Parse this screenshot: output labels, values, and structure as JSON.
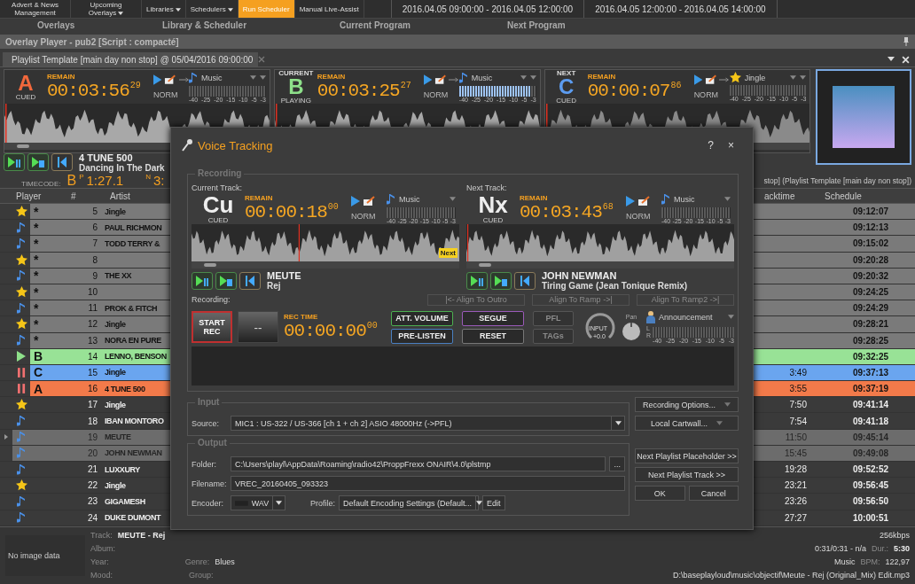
{
  "ribbon": [
    {
      "label": "Advert & News Management",
      "caret": false,
      "selected": false
    },
    {
      "label": "Upcoming Overlays",
      "caret": true,
      "selected": false
    },
    {
      "label": "Libraries",
      "caret": true,
      "selected": false
    },
    {
      "label": "Schedulers",
      "caret": true,
      "selected": false
    },
    {
      "label": "Run Scheduler",
      "caret": false,
      "selected": true
    },
    {
      "label": "Manual Live-Assist",
      "caret": false,
      "selected": false
    }
  ],
  "program_slots": [
    "2016.04.05 09:00:00 - 2016.04.05 12:00:00",
    "2016.04.05 12:00:00 - 2016.04.05 14:00:00"
  ],
  "groups": [
    "Overlays",
    "Library & Scheduler",
    "Current Program",
    "Next Program"
  ],
  "overlay_player": {
    "title": "Overlay Player - pub2 [Script : compacté]"
  },
  "tab": {
    "label": "Playlist Template [main day non stop] @ 05/04/2016 09:00:00",
    "selected": true
  },
  "decks": [
    {
      "letter": "A",
      "color": "#f2683c",
      "status": "CUED",
      "remain_label": "REMAIN",
      "time": "00:03:56",
      "frames": "29",
      "mode": "NORM",
      "category": "Music",
      "kind": "music",
      "meter_scale": [
        "-40",
        "-25",
        "-20",
        "-15",
        "-10",
        "-5",
        "-3"
      ]
    },
    {
      "letter": "B",
      "color": "#8ee08a",
      "heading": "CURRENT",
      "status": "PLAYING",
      "remain_label": "REMAIN",
      "time": "00:03:25",
      "frames": "27",
      "mode": "NORM",
      "category": "Music",
      "kind": "music",
      "meter_scale": [
        "-40",
        "-25",
        "-20",
        "-15",
        "-10",
        "-5",
        "-3"
      ],
      "level": 0.92
    },
    {
      "letter": "C",
      "color": "#5c9cf0",
      "heading": "NEXT",
      "status": "CUED",
      "remain_label": "REMAIN",
      "time": "00:00:07",
      "frames": "86",
      "mode": "NORM",
      "category": "Jingle",
      "kind": "jingle",
      "meter_scale": [
        "-40",
        "-25",
        "-20",
        "-15",
        "-10",
        "-5",
        "-3"
      ]
    }
  ],
  "now_playing": {
    "artist": "4 TUNE 500",
    "title": "Dancing In The Dark"
  },
  "timecode": {
    "label": "TIMECODE:",
    "deck": "B",
    "played_prefix": "P",
    "played": "1:27.1",
    "next_prefix": "N",
    "next": "3:"
  },
  "playlist_caption": "stop] (Playlist Template [main day non stop])",
  "table": {
    "columns": [
      "Player",
      "#",
      "Artist",
      "acktime",
      "Schedule"
    ],
    "rows": [
      {
        "kind": "jingle",
        "letter": "*",
        "number": "5",
        "artist": "Jingle",
        "schedule": "09:12:07",
        "color": "#7a7a7a",
        "dimmed": false,
        "focused": false
      },
      {
        "kind": "music",
        "letter": "*",
        "number": "6",
        "artist": "PAUL RICHMON",
        "schedule": "09:12:13",
        "color": "#7a7a7a",
        "dimmed": false,
        "focused": false
      },
      {
        "kind": "music",
        "letter": "*",
        "number": "7",
        "artist": "TODD TERRY &",
        "schedule": "09:15:02",
        "color": "#7a7a7a",
        "dimmed": false,
        "focused": false
      },
      {
        "kind": "jingle",
        "letter": "*",
        "number": "8",
        "schedule": "09:20:28",
        "color": "#7a7a7a",
        "dimmed": false,
        "focused": false
      },
      {
        "kind": "music",
        "letter": "*",
        "number": "9",
        "artist": "THE XX",
        "schedule": "09:20:32",
        "color": "#7a7a7a",
        "dimmed": false,
        "focused": false
      },
      {
        "kind": "jingle",
        "letter": "*",
        "number": "10",
        "schedule": "09:24:25",
        "color": "#7a7a7a",
        "dimmed": false,
        "focused": false
      },
      {
        "kind": "music",
        "letter": "*",
        "number": "11",
        "artist": "PROK & FITCH",
        "schedule": "09:24:29",
        "color": "#7a7a7a",
        "dimmed": false,
        "focused": false
      },
      {
        "kind": "jingle",
        "letter": "*",
        "number": "12",
        "artist": "Jingle",
        "schedule": "09:28:21",
        "color": "#7a7a7a",
        "dimmed": false,
        "focused": false
      },
      {
        "kind": "music",
        "letter": "*",
        "number": "13",
        "artist": "NORA EN PURE",
        "schedule": "09:28:25",
        "color": "#7a7a7a",
        "dimmed": false,
        "focused": false
      },
      {
        "kind": "playing",
        "letter": "B",
        "number": "14",
        "artist": "LENNO, BENSON",
        "schedule": "09:32:25",
        "color": "#98e296",
        "dimmed": false,
        "focused": false
      },
      {
        "kind": "paused",
        "letter": "C",
        "number": "15",
        "artist": "Jingle",
        "backtime": "3:49",
        "schedule": "09:37:13",
        "color": "#6aa5ef",
        "dimmed": false,
        "focused": false
      },
      {
        "kind": "paused",
        "letter": "A",
        "number": "16",
        "artist": "4 TUNE 500",
        "backtime": "3:55",
        "schedule": "09:37:19",
        "color": "#f27a4a",
        "dimmed": false,
        "focused": false
      },
      {
        "kind": "jingle",
        "number": "17",
        "artist": "Jingle",
        "backtime": "7:50",
        "schedule": "09:41:14",
        "color": "#3a3a3a",
        "dimmed": false,
        "focused": false
      },
      {
        "kind": "music",
        "number": "18",
        "artist": "IBAN MONTORO",
        "backtime": "7:54",
        "schedule": "09:41:18",
        "color": "#3a3a3a",
        "dimmed": false,
        "focused": false
      },
      {
        "kind": "music",
        "number": "19",
        "artist": "MEUTE",
        "backtime": "11:50",
        "schedule": "09:45:14",
        "color": "#6c6c6c",
        "dimmed": true,
        "focused": true
      },
      {
        "kind": "music",
        "number": "20",
        "artist": "JOHN NEWMAN",
        "backtime": "15:45",
        "schedule": "09:49:08",
        "color": "#6c6c6c",
        "dimmed": true,
        "focused": false
      },
      {
        "kind": "music",
        "number": "21",
        "artist": "LUXXURY",
        "backtime": "19:28",
        "schedule": "09:52:52",
        "color": "#3a3a3a",
        "dimmed": false,
        "focused": false
      },
      {
        "kind": "jingle",
        "number": "22",
        "artist": "Jingle",
        "backtime": "23:21",
        "schedule": "09:56:45",
        "color": "#3a3a3a",
        "dimmed": false,
        "focused": false
      },
      {
        "kind": "music",
        "number": "23",
        "artist": "GIGAMESH",
        "backtime": "23:26",
        "schedule": "09:56:50",
        "color": "#3a3a3a",
        "dimmed": false,
        "focused": false
      },
      {
        "kind": "music",
        "number": "24",
        "artist": "DUKE DUMONT",
        "backtime": "27:27",
        "schedule": "10:00:51",
        "color": "#3a3a3a",
        "dimmed": false,
        "focused": false
      }
    ]
  },
  "info": {
    "image": "No image data",
    "track_label": "Track:",
    "track": "MEUTE - Rej",
    "album_label": "Album:",
    "year_label": "Year:",
    "genre_label": "Genre:",
    "genre": "Blues",
    "mood_label": "Mood:",
    "group_label": "Group:",
    "bitrate": "256kbps",
    "position": "0:31/0:31 - n/a",
    "duration_label": "Dur.:",
    "duration": "5:30",
    "category": "Music",
    "bpm_label": "BPM:",
    "bpm": "122,97",
    "path": "D:\\baseplayloud\\music\\objectif\\Meute - Rej (Original_Mix) Edit.mp3"
  },
  "dialog": {
    "title": "Voice Tracking",
    "help": "?",
    "close": "×",
    "recording_legend": "Recording",
    "tracks": [
      {
        "label": "Current Track:",
        "code": "Cu",
        "status": "CUED",
        "remain_label": "REMAIN",
        "time": "00:00:18",
        "frames": "00",
        "mode": "NORM",
        "category": "Music",
        "meter_scale": [
          "-40",
          "-25",
          "-20",
          "-15",
          "-10",
          "-5",
          "-3"
        ],
        "marker": "Next",
        "artist": "MEUTE",
        "title": "Rej"
      },
      {
        "label": "Next Track:",
        "code": "Nx",
        "status": "CUED",
        "remain_label": "REMAIN",
        "time": "00:03:43",
        "frames": "68",
        "mode": "NORM",
        "category": "Music",
        "meter_scale": [
          "-40",
          "-25",
          "-20",
          "-15",
          "-10",
          "-5",
          "-3"
        ],
        "artist": "JOHN NEWMAN",
        "title": "Tiring Game (Jean Tonique Remix)"
      }
    ],
    "recording_label": "Recording:",
    "align_buttons": [
      {
        "label": "|<- Align To Outro",
        "disabled": true
      },
      {
        "label": "Align To Ramp ->|",
        "disabled": true
      },
      {
        "label": "Align To Ramp2 ->|",
        "disabled": true
      }
    ],
    "start_rec": "START REC",
    "blank_button": "--",
    "rec_time_label": "REC TIME",
    "rec_time": "00:00:00",
    "rec_frames": "00",
    "action_buttons": [
      {
        "label": "ATT. VOLUME",
        "color": "#4caf50",
        "disabled": false
      },
      {
        "label": "PRE-LISTEN",
        "color": "#4a7fc0",
        "disabled": false
      },
      {
        "label": "SEGUE",
        "color": "#9a5ab8",
        "disabled": false
      },
      {
        "label": "RESET",
        "color": "#777777",
        "disabled": false
      },
      {
        "label": "PFL",
        "color": "#555555",
        "disabled": true
      },
      {
        "label": "TAGs",
        "color": "#555555",
        "disabled": true
      }
    ],
    "input_knob": {
      "label": "INPUT",
      "value": "+0.0"
    },
    "pan_label": "Pan",
    "output_channel": "Announcement",
    "channel_labels": [
      "L",
      "R"
    ],
    "output_scale": [
      "-40",
      "-25",
      "-20",
      "-15",
      "-10",
      "-5",
      "-3"
    ],
    "input": {
      "legend": "Input",
      "source_label": "Source:",
      "source": "MIC1 : US-322 / US-366 [ch 1 + ch 2] ASIO 48000Hz (->PFL)"
    },
    "output": {
      "legend": "Output",
      "folder_label": "Folder:",
      "folder": "C:\\Users\\playl\\AppData\\Roaming\\radio42\\ProppFrexx ONAIR\\4.0\\plstmp",
      "browse": "...",
      "filename_label": "Filename:",
      "filename": "VREC_20160405_093323",
      "encoder_label": "Encoder:",
      "encoder": "WAV",
      "profile_label": "Profile:",
      "profile": "Default Encoding Settings (Default...",
      "edit": "Edit"
    },
    "side_buttons": [
      "Recording Options...",
      "Local Cartwall..."
    ],
    "next_buttons": [
      "Next Playlist Placeholder >>",
      "Next Playlist Track >>"
    ],
    "ok": "OK",
    "cancel": "Cancel"
  }
}
